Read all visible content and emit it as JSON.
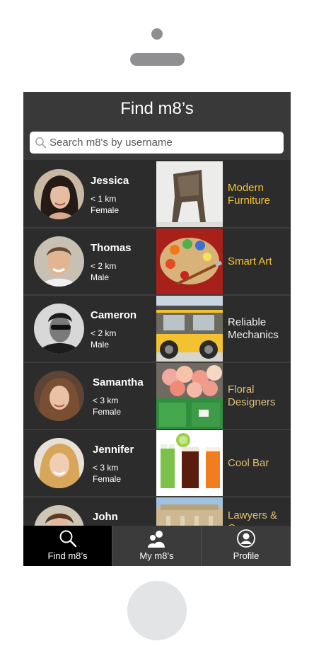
{
  "app": {
    "title": "Find m8’s",
    "search": {
      "placeholder": "Search m8's by username"
    }
  },
  "rows": [
    {
      "name": "Jessica",
      "distance": "< 1 km",
      "gender": "Female",
      "service": "Modern Furniture",
      "service_color": "#f4c430"
    },
    {
      "name": "Thomas",
      "distance": "< 2 km",
      "gender": "Male",
      "service": "Smart Art",
      "service_color": "#f4c430"
    },
    {
      "name": "Cameron",
      "distance": "< 2 km",
      "gender": "Male",
      "service": "Reliable Mechanics",
      "service_color": "#f2f2f2"
    },
    {
      "name": "Samantha",
      "distance": "< 3 km",
      "gender": "Female",
      "service": "Floral Designers",
      "service_color": "#e0bf74"
    },
    {
      "name": "Jennifer",
      "distance": "< 3 km",
      "gender": "Female",
      "service": "Cool Bar",
      "service_color": "#e0bf74"
    },
    {
      "name": "John",
      "distance": "",
      "gender": "",
      "service": "Lawyers & Co",
      "service_color": "#e0bf74"
    }
  ],
  "tabs": [
    {
      "label": "Find m8’s",
      "icon": "search-icon",
      "active": true
    },
    {
      "label": "My m8’s",
      "icon": "people-icon",
      "active": false
    },
    {
      "label": "Profile",
      "icon": "profile-icon",
      "active": false
    }
  ],
  "colors": {
    "accent_gold": "#f4c430",
    "muted_gold": "#e0bf74",
    "screen_bg": "#2b2b2b",
    "active_tab": "#000000"
  }
}
